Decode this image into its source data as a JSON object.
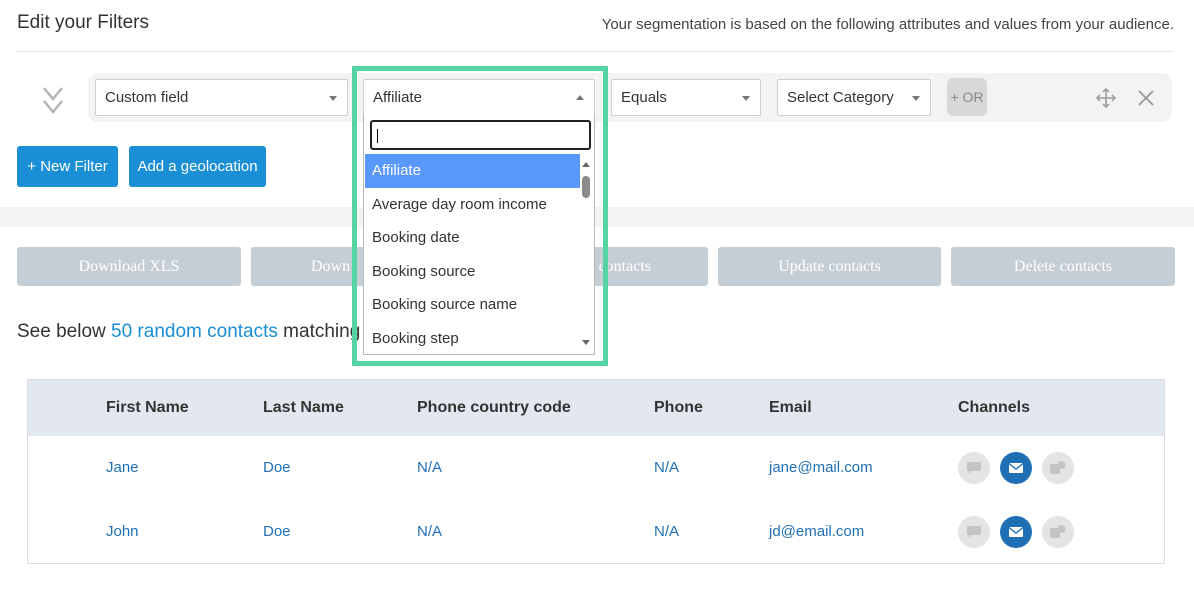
{
  "header": {
    "title": "Edit your Filters",
    "subtitle": "Your segmentation is based on the following attributes and values from your audience."
  },
  "filter": {
    "field_select": "Custom field",
    "value_select": "Affiliate",
    "operator_select": "Equals",
    "category_select": "Select Category",
    "or_label": "+ OR"
  },
  "buttons": {
    "new_filter": "+ New Filter",
    "add_geolocation": "Add a geolocation"
  },
  "actions": [
    "Download XLS",
    "Down",
    "contacts",
    "Update contacts",
    "Delete contacts"
  ],
  "contacts_line": {
    "prefix": "See below ",
    "link": "50 random contacts",
    "suffix": " matching you"
  },
  "table": {
    "headers": [
      "First Name",
      "Last Name",
      "Phone country code",
      "Phone",
      "Email",
      "Channels"
    ],
    "rows": [
      {
        "first_name": "Jane",
        "last_name": "Doe",
        "phone_country_code": "N/A",
        "phone": "N/A",
        "email": "jane@mail.com"
      },
      {
        "first_name": "John",
        "last_name": "Doe",
        "phone_country_code": "N/A",
        "phone": "N/A",
        "email": "jd@email.com"
      }
    ]
  },
  "dropdown": {
    "search_value": "",
    "items": [
      "Affiliate",
      "Average day room income",
      "Booking date",
      "Booking source",
      "Booking source name",
      "Booking step"
    ],
    "selected_index": 0
  },
  "colors": {
    "accent": "#1a8fd6",
    "highlight": "#56d3a3",
    "selected": "#5897fb",
    "disabled_button": "#c6ced5"
  }
}
